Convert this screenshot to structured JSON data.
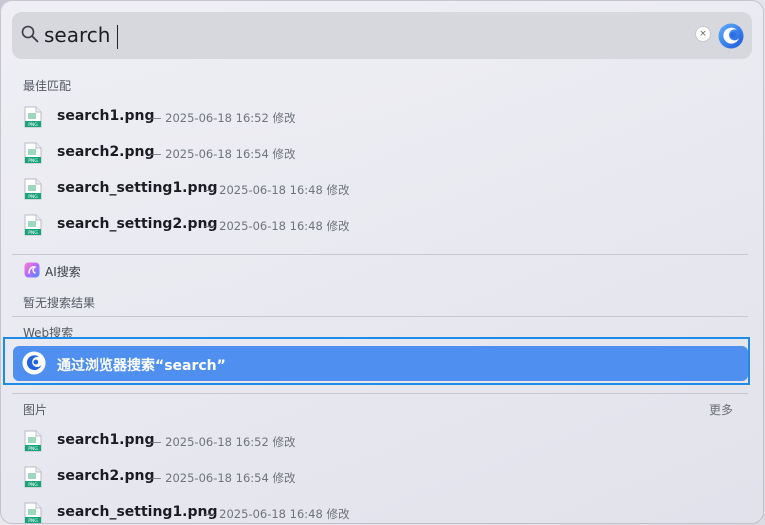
{
  "search": {
    "query": "search",
    "clear_glyph": "×"
  },
  "best_match": {
    "title": "最佳匹配",
    "items": [
      {
        "name": "search1.png",
        "meta": "— 2025-06-18 16:52 修改"
      },
      {
        "name": "search2.png",
        "meta": "— 2025-06-18 16:54 修改"
      },
      {
        "name": "search_setting1.png",
        "meta": "— 2025-06-18 16:48 修改"
      },
      {
        "name": "search_setting2.png",
        "meta": "— 2025-06-18 16:48 修改"
      }
    ]
  },
  "ai_search": {
    "label": "AI搜索",
    "empty_text": "暂无搜索结果"
  },
  "web_search": {
    "title": "Web搜索",
    "action_label": "通过浏览器搜索“search”"
  },
  "images": {
    "title": "图片",
    "more_label": "更多",
    "items": [
      {
        "name": "search1.png",
        "meta": "— 2025-06-18 16:52 修改"
      },
      {
        "name": "search2.png",
        "meta": "— 2025-06-18 16:54 修改"
      },
      {
        "name": "search_setting1.png",
        "meta": "— 2025-06-18 16:48 修改"
      }
    ]
  },
  "colors": {
    "accent": "#4f8ff0",
    "focus_ring": "#1e8be6",
    "png_badge": "#1aa37a"
  },
  "icons": {
    "search": "magnifier-icon",
    "browser": "browser-swirl-icon",
    "file": "png-file-icon",
    "ai": "ai-search-icon"
  }
}
